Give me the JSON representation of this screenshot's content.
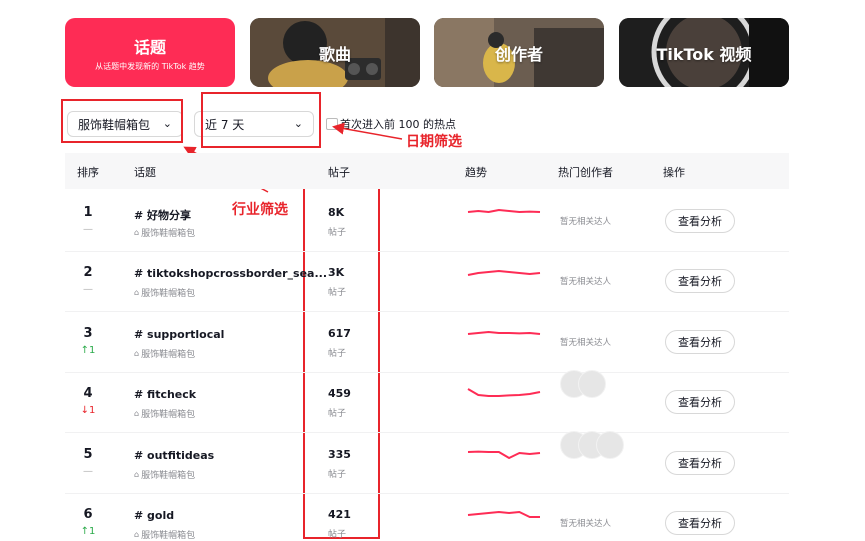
{
  "tabs": [
    {
      "title": "话题",
      "subtitle": "从话题中发现新的 TikTok 趋势"
    },
    {
      "title": "歌曲"
    },
    {
      "title": "创作者"
    },
    {
      "title": "TikTok 视频"
    }
  ],
  "filters": {
    "industry": "服饰鞋帽箱包",
    "date": "近 7 天",
    "first_top100_label": "首次进入前 100 的热点"
  },
  "annotations": {
    "date_filter": "日期筛选",
    "industry_filter": "行业筛选"
  },
  "table": {
    "headers": {
      "rank": "排序",
      "topic": "话题",
      "posts": "帖子",
      "trend": "趋势",
      "creators": "热门创作者",
      "action": "操作"
    },
    "rows": [
      {
        "rank": "1",
        "change": "—",
        "change_dir": "none",
        "tag": "# 好物分享",
        "industry": "服饰鞋帽箱包",
        "posts": "8K",
        "posts_label": "帖子",
        "creators": "暂无相关达人",
        "avatars": 0,
        "action": "查看分析",
        "trend": [
          0.5,
          0.55,
          0.5,
          0.6,
          0.55,
          0.5,
          0.52,
          0.5
        ]
      },
      {
        "rank": "2",
        "change": "—",
        "change_dir": "none",
        "tag": "# tiktokshopcrossborder_sea...",
        "industry": "服饰鞋帽箱包",
        "posts": "3K",
        "posts_label": "帖子",
        "creators": "暂无相关达人",
        "avatars": 0,
        "action": "查看分析",
        "trend": [
          0.35,
          0.45,
          0.5,
          0.55,
          0.5,
          0.45,
          0.4,
          0.45
        ]
      },
      {
        "rank": "3",
        "change": "↑1",
        "change_dir": "up",
        "tag": "# supportlocal",
        "industry": "服饰鞋帽箱包",
        "posts": "617",
        "posts_label": "帖子",
        "creators": "暂无相关达人",
        "avatars": 0,
        "action": "查看分析",
        "trend": [
          0.45,
          0.5,
          0.55,
          0.5,
          0.5,
          0.48,
          0.5,
          0.45
        ]
      },
      {
        "rank": "4",
        "change": "↓1",
        "change_dir": "down",
        "tag": "# fitcheck",
        "industry": "服饰鞋帽箱包",
        "posts": "459",
        "posts_label": "帖子",
        "creators": "",
        "avatars": 2,
        "action": "查看分析",
        "trend": [
          0.7,
          0.4,
          0.35,
          0.35,
          0.38,
          0.4,
          0.45,
          0.55
        ]
      },
      {
        "rank": "5",
        "change": "—",
        "change_dir": "none",
        "tag": "# outfitideas",
        "industry": "服饰鞋帽箱包",
        "posts": "335",
        "posts_label": "帖子",
        "creators": "",
        "avatars": 3,
        "action": "查看分析",
        "trend": [
          0.6,
          0.62,
          0.6,
          0.6,
          0.3,
          0.55,
          0.5,
          0.55
        ]
      },
      {
        "rank": "6",
        "change": "↑1",
        "change_dir": "up",
        "tag": "# gold",
        "industry": "服饰鞋帽箱包",
        "posts": "421",
        "posts_label": "帖子",
        "creators": "暂无相关达人",
        "avatars": 0,
        "action": "查看分析",
        "trend": [
          0.45,
          0.5,
          0.55,
          0.6,
          0.55,
          0.6,
          0.35,
          0.35
        ]
      }
    ]
  },
  "colors": {
    "accent": "#fe2c55",
    "annotation_red": "#e8242b",
    "up": "#2baa4a",
    "down": "#e8242b",
    "trend_line": "#fe2c55"
  }
}
